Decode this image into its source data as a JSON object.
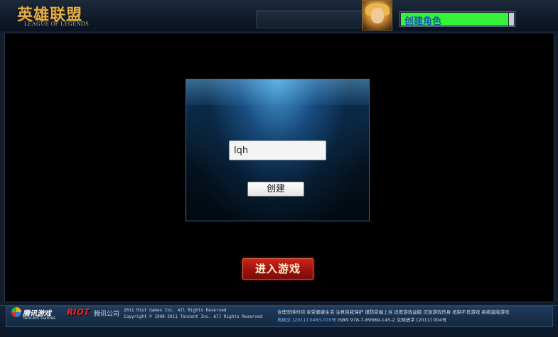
{
  "header": {
    "logo_cn": "英雄联盟",
    "logo_en": "LEAGUE OF LEGENDS",
    "name_bar_text": "创建角色",
    "name_bar_fill": 0.95
  },
  "dialog": {
    "name_input_value": "lqh",
    "create_button": "创建"
  },
  "enter_button": "进入游戏",
  "footer": {
    "tencent_cn": "腾讯游戏",
    "tencent_en": "Tencent Games",
    "riot": "RIOT",
    "company": "腾讯公司",
    "copyright_1": "2011 Riot Games Inc. All Rights Reserved",
    "copyright_2": "Copyright © 1998-2011 Tencent Inc. All Rights Reserved",
    "health_line_1": "合理安排时间 享受健康生活 注意自我保护 谨防受骗上当 适度游戏益脑 沉迷游戏伤身 抵制不良游戏 拒绝盗版游戏",
    "health_line_2_a": "粤网文 [2011] 0483-070号",
    "health_line_2_b": " ISBN 978-7-89989-145-2  文网进字 [2011] 004号"
  }
}
